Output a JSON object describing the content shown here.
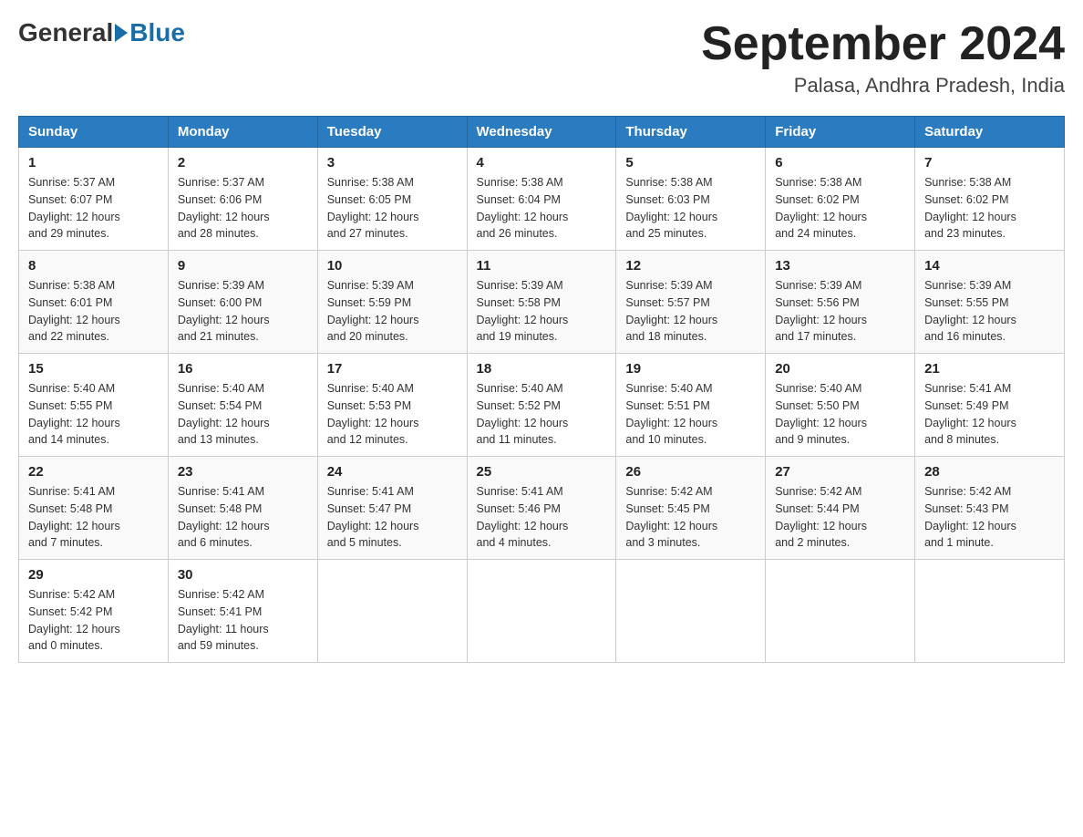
{
  "logo": {
    "general": "General",
    "blue": "Blue"
  },
  "title": "September 2024",
  "subtitle": "Palasa, Andhra Pradesh, India",
  "weekdays": [
    "Sunday",
    "Monday",
    "Tuesday",
    "Wednesday",
    "Thursday",
    "Friday",
    "Saturday"
  ],
  "weeks": [
    [
      {
        "day": "1",
        "sunrise": "5:37 AM",
        "sunset": "6:07 PM",
        "daylight": "12 hours and 29 minutes."
      },
      {
        "day": "2",
        "sunrise": "5:37 AM",
        "sunset": "6:06 PM",
        "daylight": "12 hours and 28 minutes."
      },
      {
        "day": "3",
        "sunrise": "5:38 AM",
        "sunset": "6:05 PM",
        "daylight": "12 hours and 27 minutes."
      },
      {
        "day": "4",
        "sunrise": "5:38 AM",
        "sunset": "6:04 PM",
        "daylight": "12 hours and 26 minutes."
      },
      {
        "day": "5",
        "sunrise": "5:38 AM",
        "sunset": "6:03 PM",
        "daylight": "12 hours and 25 minutes."
      },
      {
        "day": "6",
        "sunrise": "5:38 AM",
        "sunset": "6:02 PM",
        "daylight": "12 hours and 24 minutes."
      },
      {
        "day": "7",
        "sunrise": "5:38 AM",
        "sunset": "6:02 PM",
        "daylight": "12 hours and 23 minutes."
      }
    ],
    [
      {
        "day": "8",
        "sunrise": "5:38 AM",
        "sunset": "6:01 PM",
        "daylight": "12 hours and 22 minutes."
      },
      {
        "day": "9",
        "sunrise": "5:39 AM",
        "sunset": "6:00 PM",
        "daylight": "12 hours and 21 minutes."
      },
      {
        "day": "10",
        "sunrise": "5:39 AM",
        "sunset": "5:59 PM",
        "daylight": "12 hours and 20 minutes."
      },
      {
        "day": "11",
        "sunrise": "5:39 AM",
        "sunset": "5:58 PM",
        "daylight": "12 hours and 19 minutes."
      },
      {
        "day": "12",
        "sunrise": "5:39 AM",
        "sunset": "5:57 PM",
        "daylight": "12 hours and 18 minutes."
      },
      {
        "day": "13",
        "sunrise": "5:39 AM",
        "sunset": "5:56 PM",
        "daylight": "12 hours and 17 minutes."
      },
      {
        "day": "14",
        "sunrise": "5:39 AM",
        "sunset": "5:55 PM",
        "daylight": "12 hours and 16 minutes."
      }
    ],
    [
      {
        "day": "15",
        "sunrise": "5:40 AM",
        "sunset": "5:55 PM",
        "daylight": "12 hours and 14 minutes."
      },
      {
        "day": "16",
        "sunrise": "5:40 AM",
        "sunset": "5:54 PM",
        "daylight": "12 hours and 13 minutes."
      },
      {
        "day": "17",
        "sunrise": "5:40 AM",
        "sunset": "5:53 PM",
        "daylight": "12 hours and 12 minutes."
      },
      {
        "day": "18",
        "sunrise": "5:40 AM",
        "sunset": "5:52 PM",
        "daylight": "12 hours and 11 minutes."
      },
      {
        "day": "19",
        "sunrise": "5:40 AM",
        "sunset": "5:51 PM",
        "daylight": "12 hours and 10 minutes."
      },
      {
        "day": "20",
        "sunrise": "5:40 AM",
        "sunset": "5:50 PM",
        "daylight": "12 hours and 9 minutes."
      },
      {
        "day": "21",
        "sunrise": "5:41 AM",
        "sunset": "5:49 PM",
        "daylight": "12 hours and 8 minutes."
      }
    ],
    [
      {
        "day": "22",
        "sunrise": "5:41 AM",
        "sunset": "5:48 PM",
        "daylight": "12 hours and 7 minutes."
      },
      {
        "day": "23",
        "sunrise": "5:41 AM",
        "sunset": "5:48 PM",
        "daylight": "12 hours and 6 minutes."
      },
      {
        "day": "24",
        "sunrise": "5:41 AM",
        "sunset": "5:47 PM",
        "daylight": "12 hours and 5 minutes."
      },
      {
        "day": "25",
        "sunrise": "5:41 AM",
        "sunset": "5:46 PM",
        "daylight": "12 hours and 4 minutes."
      },
      {
        "day": "26",
        "sunrise": "5:42 AM",
        "sunset": "5:45 PM",
        "daylight": "12 hours and 3 minutes."
      },
      {
        "day": "27",
        "sunrise": "5:42 AM",
        "sunset": "5:44 PM",
        "daylight": "12 hours and 2 minutes."
      },
      {
        "day": "28",
        "sunrise": "5:42 AM",
        "sunset": "5:43 PM",
        "daylight": "12 hours and 1 minute."
      }
    ],
    [
      {
        "day": "29",
        "sunrise": "5:42 AM",
        "sunset": "5:42 PM",
        "daylight": "12 hours and 0 minutes."
      },
      {
        "day": "30",
        "sunrise": "5:42 AM",
        "sunset": "5:41 PM",
        "daylight": "11 hours and 59 minutes."
      },
      null,
      null,
      null,
      null,
      null
    ]
  ],
  "labels": {
    "sunrise": "Sunrise:",
    "sunset": "Sunset:",
    "daylight": "Daylight:"
  }
}
